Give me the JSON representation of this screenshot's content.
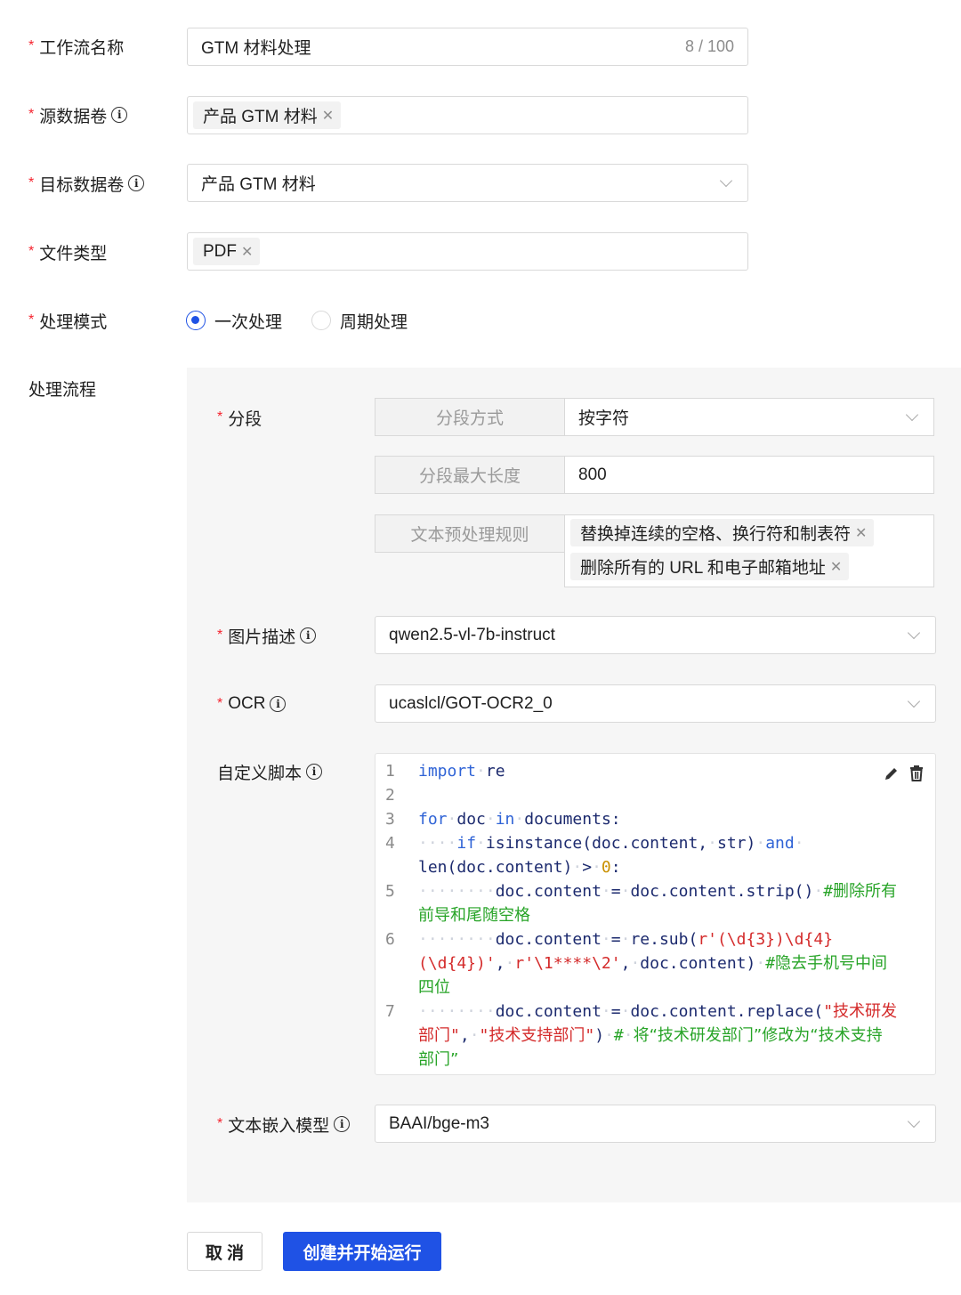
{
  "form": {
    "workflow_name": {
      "label": "工作流名称",
      "value": "GTM 材料处理",
      "counter": "8 / 100"
    },
    "source_volume": {
      "label": "源数据卷",
      "tags": [
        "产品 GTM 材料"
      ]
    },
    "target_volume": {
      "label": "目标数据卷",
      "value": "产品 GTM 材料"
    },
    "file_type": {
      "label": "文件类型",
      "tags": [
        "PDF"
      ]
    },
    "process_mode": {
      "label": "处理模式",
      "options": [
        "一次处理",
        "周期处理"
      ],
      "selected": "一次处理"
    },
    "pipeline_label": "处理流程"
  },
  "pipeline": {
    "segment": {
      "label": "分段",
      "method_label": "分段方式",
      "method_value": "按字符",
      "maxlen_label": "分段最大长度",
      "maxlen_value": "800",
      "rules_label": "文本预处理规则",
      "rules": [
        "替换掉连续的空格、换行符和制表符",
        "删除所有的 URL 和电子邮箱地址"
      ]
    },
    "image_desc": {
      "label": "图片描述",
      "value": "qwen2.5-vl-7b-instruct"
    },
    "ocr": {
      "label": "OCR",
      "value": "ucaslcl/GOT-OCR2_0"
    },
    "custom_script": {
      "label": "自定义脚本",
      "line_numbers": [
        "1",
        "2",
        "3",
        "4",
        "5",
        "6",
        "7"
      ]
    },
    "embedding": {
      "label": "文本嵌入模型",
      "value": "BAAI/bge-m3"
    }
  },
  "buttons": {
    "cancel": "取 消",
    "create": "创建并开始运行"
  },
  "colors": {
    "primary": "#1f52e5",
    "required": "#f5222d",
    "panel_bg": "#f6f6f6"
  },
  "icons": {
    "info": "info-circle-icon",
    "edit": "pencil-icon",
    "delete": "trash-icon",
    "dropdown": "chevron-down-icon",
    "remove_tag": "close-icon"
  }
}
